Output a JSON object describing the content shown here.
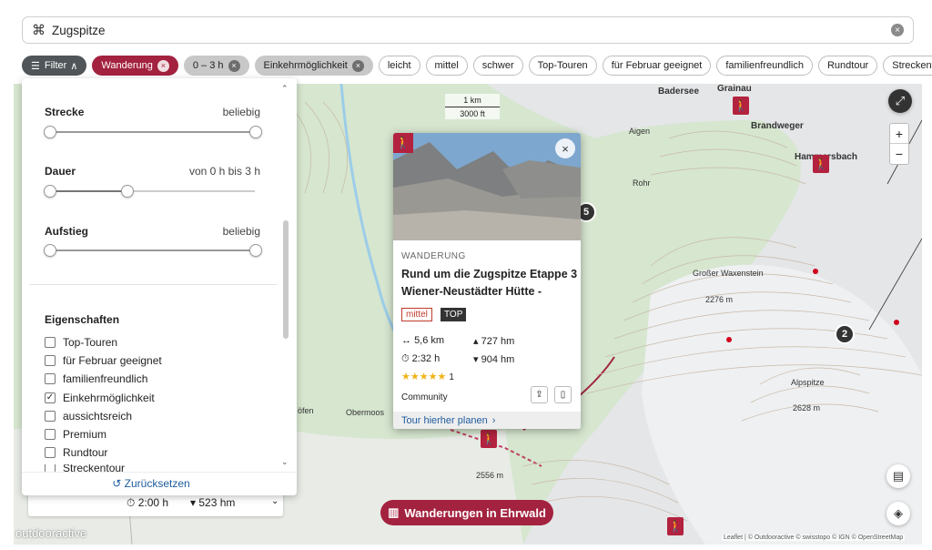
{
  "search": {
    "query": "Zugspitze",
    "icon": "command-icon",
    "clear_label": "×"
  },
  "chips": [
    {
      "label": "Filter",
      "arrow": "∧",
      "style": "dark"
    },
    {
      "label": "Wanderung",
      "style": "red",
      "removable": true
    },
    {
      "label": "0 – 3 h",
      "style": "grey",
      "removable": true
    },
    {
      "label": "Einkehrmöglichkeit",
      "style": "grey",
      "removable": true
    },
    {
      "label": "leicht"
    },
    {
      "label": "mittel"
    },
    {
      "label": "schwer"
    },
    {
      "label": "Top-Touren"
    },
    {
      "label": "für Februar geeignet"
    },
    {
      "label": "familienfreundlich"
    },
    {
      "label": "Rundtour"
    },
    {
      "label": "Streckentour"
    }
  ],
  "filter_panel": {
    "strecke": {
      "title": "Strecke",
      "value": "beliebig"
    },
    "dauer": {
      "title": "Dauer",
      "value": "von 0 h bis 3 h"
    },
    "aufstieg": {
      "title": "Aufstieg",
      "value": "beliebig"
    },
    "eigenschaften_title": "Eigenschaften",
    "checkboxes": [
      {
        "label": "Top-Touren",
        "checked": false
      },
      {
        "label": "für Februar geeignet",
        "checked": false
      },
      {
        "label": "familienfreundlich",
        "checked": false
      },
      {
        "label": "Einkehrmöglichkeit",
        "checked": true
      },
      {
        "label": "aussichtsreich",
        "checked": false
      },
      {
        "label": "Premium",
        "checked": false
      },
      {
        "label": "Rundtour",
        "checked": false
      },
      {
        "label": "Streckentour",
        "checked": false
      }
    ],
    "reset_label": "Zurücksetzen"
  },
  "popup": {
    "category": "WANDERUNG",
    "title_line1": "Rund um die Zugspitze Etappe 3",
    "title_line2": "Wiener-Neustädter Hütte -",
    "difficulty": "mittel",
    "top_badge": "TOP",
    "distance": "5,6 km",
    "ascent": "727 hm",
    "duration": "2:32 h",
    "descent": "904 hm",
    "rating_stars": "★★★★★",
    "rating_count": "1",
    "author": "Community",
    "plan_link": "Tour hierher planen",
    "plan_arrow": "›"
  },
  "left_card": {
    "duration": "2:00 h",
    "descent": "523 hm"
  },
  "map": {
    "labels": [
      {
        "text": "Badersee",
        "bold": true
      },
      {
        "text": "Grainau",
        "bold": true
      },
      {
        "text": "Brandweger",
        "bold": true
      },
      {
        "text": "Hammersbach",
        "bold": true
      },
      {
        "text": "Aigen"
      },
      {
        "text": "Rohr"
      },
      {
        "text": "Großer Waxenstein"
      },
      {
        "text": "2276 m"
      },
      {
        "text": "Alpspitze"
      },
      {
        "text": "2628 m"
      },
      {
        "text": "Obermoos"
      },
      {
        "text": "2556 m"
      },
      {
        "text": "öfen"
      }
    ],
    "scale_km": "1 km",
    "scale_ft": "3000 ft",
    "clusters": [
      "5",
      "2"
    ],
    "attribution": "Leaflet | © Outdooractive © swisstopo © IGN © OpenStreetMap",
    "logo": "outdooractive"
  },
  "cta": {
    "label": "Wanderungen in Ehrwald"
  },
  "colors": {
    "brand_red": "#a3223f",
    "link_blue": "#1f5c9e"
  }
}
